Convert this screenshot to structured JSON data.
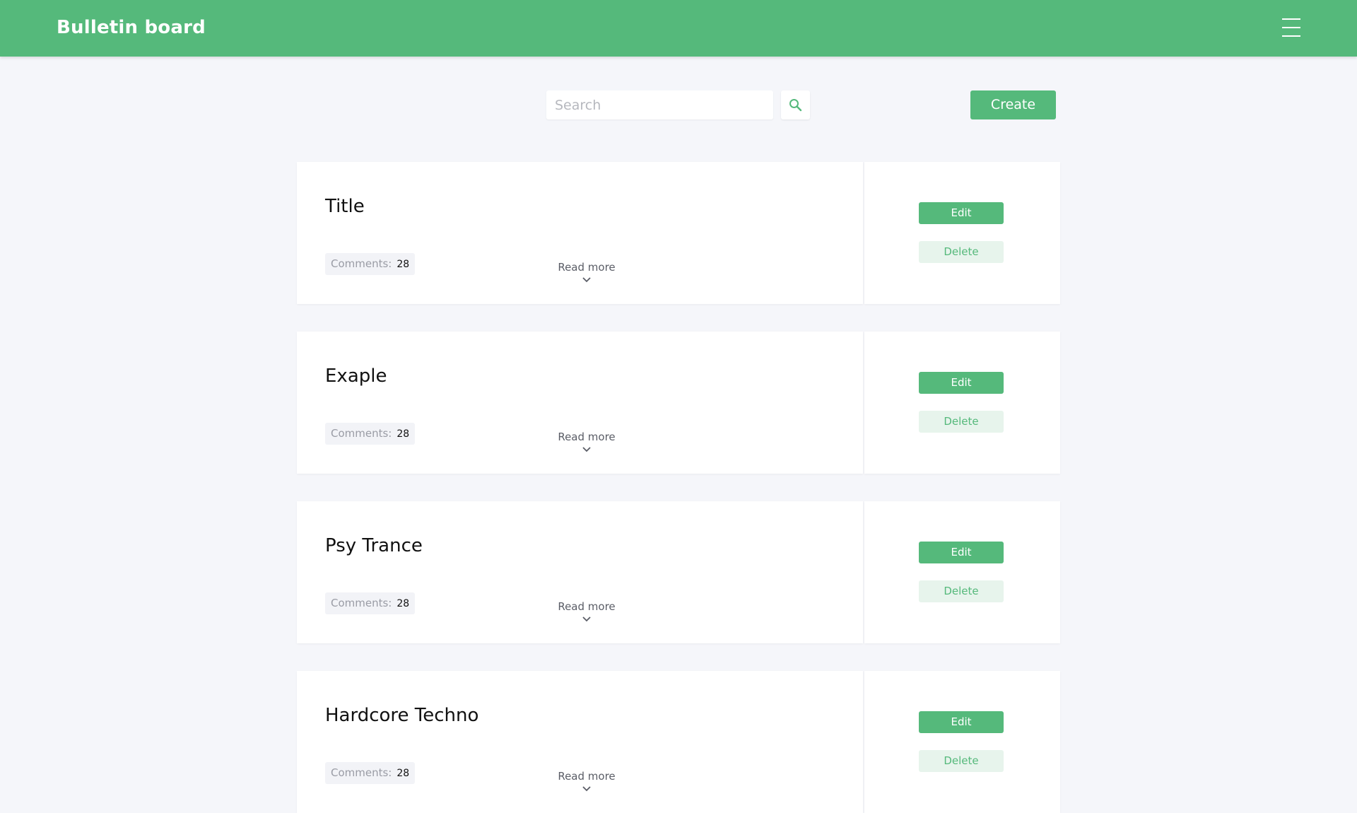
{
  "app": {
    "brand": "Bulletin board",
    "accent_color": "#55b97b",
    "menu_icon": "hamburger-menu-icon"
  },
  "toolbar": {
    "search_placeholder": "Search",
    "search_value": "",
    "search_icon": "search-icon",
    "create_label": "Create"
  },
  "posts": [
    {
      "title": "Title",
      "comments_label": "Comments:",
      "comments_count": "28",
      "read_more": "Read more",
      "edit_label": "Edit",
      "delete_label": "Delete"
    },
    {
      "title": "Exaple",
      "comments_label": "Comments:",
      "comments_count": "28",
      "read_more": "Read more",
      "edit_label": "Edit",
      "delete_label": "Delete"
    },
    {
      "title": "Psy Trance",
      "comments_label": "Comments:",
      "comments_count": "28",
      "read_more": "Read more",
      "edit_label": "Edit",
      "delete_label": "Delete"
    },
    {
      "title": "Hardcore Techno",
      "comments_label": "Comments:",
      "comments_count": "28",
      "read_more": "Read more",
      "edit_label": "Edit",
      "delete_label": "Delete"
    }
  ]
}
